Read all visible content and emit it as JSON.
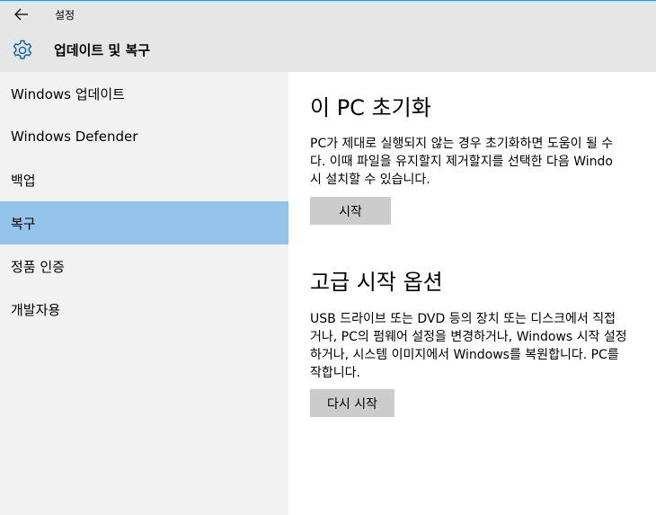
{
  "titlebar": {
    "title": "설정",
    "back_icon": "back-arrow-icon"
  },
  "header": {
    "title": "업데이트 및 복구",
    "icon": "gear-icon"
  },
  "sidebar": {
    "items": [
      {
        "label": "Windows 업데이트",
        "selected": false
      },
      {
        "label": "Windows Defender",
        "selected": false
      },
      {
        "label": "백업",
        "selected": false
      },
      {
        "label": "복구",
        "selected": true
      },
      {
        "label": "정품 인증",
        "selected": false
      },
      {
        "label": "개발자용",
        "selected": false
      }
    ]
  },
  "main": {
    "reset": {
      "title": "이 PC 초기화",
      "desc_lines": [
        "PC가 제대로 실행되지 않는 경우 초기화하면 도움이 될 수",
        "다. 이때 파일을 유지할지 제거할지를 선택한 다음 Windo",
        "시 설치할 수 있습니다."
      ],
      "button_label": "시작"
    },
    "advanced": {
      "title": "고급 시작 옵션",
      "desc_lines": [
        "USB 드라이브 또는 DVD 등의 장치 또는 디스크에서 직접",
        "거나, PC의 펌웨어 설정을 변경하거나, Windows 시작 설정",
        "하거나, 시스템 이미지에서 Windows를 복원합니다. PC를",
        "작합니다."
      ],
      "button_label": "다시 시작"
    }
  },
  "colors": {
    "chrome_bg": "#e6e6e6",
    "sidebar_bg": "#f2f2f2",
    "selected_bg": "#94c3eb",
    "button_bg": "#cccccc",
    "accent": "#0063b1"
  }
}
